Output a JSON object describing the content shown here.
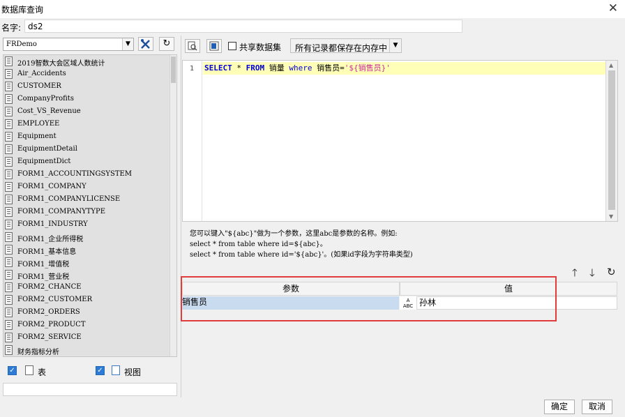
{
  "window": {
    "title": "数据库查询",
    "close_glyph": "✕"
  },
  "name_field": {
    "label": "名字:",
    "value": "ds2"
  },
  "datasource": {
    "selected": "FRDemo"
  },
  "tables": [
    "2019智数大会区域人数统计",
    "Air_Accidents",
    "CUSTOMER",
    "CompanyProfits",
    "Cost_VS_Revenue",
    "EMPLOYEE",
    "Equipment",
    "EquipmentDetail",
    "EquipmentDict",
    "FORM1_ACCOUNTINGSYSTEM",
    "FORM1_COMPANY",
    "FORM1_COMPANYLICENSE",
    "FORM1_COMPANYTYPE",
    "FORM1_INDUSTRY",
    "FORM1_企业所得税",
    "FORM1_基本信息",
    "FORM1_增值税",
    "FORM1_营业税",
    "FORM2_CHANCE",
    "FORM2_CUSTOMER",
    "FORM2_ORDERS",
    "FORM2_PRODUCT",
    "FORM2_SERVICE",
    "财务指标分析"
  ],
  "filters": {
    "table_label": "表",
    "view_label": "视图"
  },
  "toolbar": {
    "share_label": "共享数据集",
    "memory_option": "所有记录都保存在内存中"
  },
  "sql": {
    "line_number": "1",
    "k_select": "SELECT",
    "star": "*",
    "k_from": "FROM",
    "table": "销量",
    "k_where": "where",
    "column": "销售员=",
    "param": "'${销售员}'"
  },
  "hint": {
    "line1": "您可以键入\"${abc}\"做为一个参数，这里abc是参数的名称。例如:",
    "line2": "select * from table where id=${abc}。",
    "line3": "select * from table where id='${abc}'。(如果id字段为字符串类型)"
  },
  "params": {
    "header_param": "参数",
    "header_value": "值",
    "rows": [
      {
        "name": "销售员",
        "type_icon": "abc-type-icon",
        "value": "孙林"
      }
    ]
  },
  "buttons": {
    "ok": "确定",
    "cancel": "取消"
  }
}
